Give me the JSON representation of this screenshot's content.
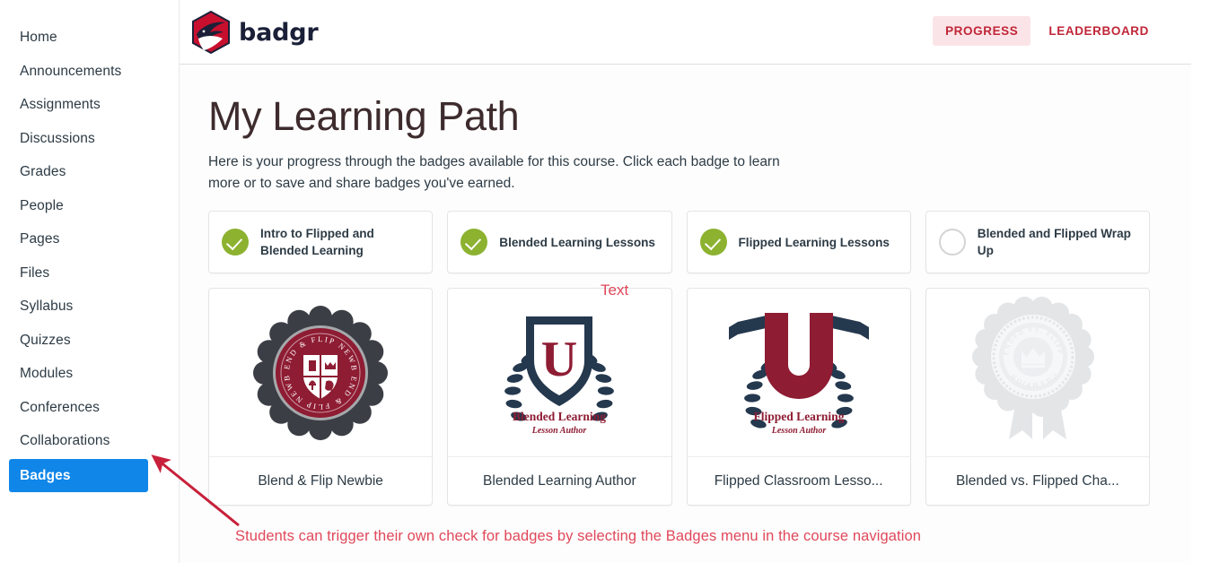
{
  "sidebar": {
    "items": [
      {
        "label": "Home",
        "active": false
      },
      {
        "label": "Announcements",
        "active": false
      },
      {
        "label": "Assignments",
        "active": false
      },
      {
        "label": "Discussions",
        "active": false
      },
      {
        "label": "Grades",
        "active": false
      },
      {
        "label": "People",
        "active": false
      },
      {
        "label": "Pages",
        "active": false
      },
      {
        "label": "Files",
        "active": false
      },
      {
        "label": "Syllabus",
        "active": false
      },
      {
        "label": "Quizzes",
        "active": false
      },
      {
        "label": "Modules",
        "active": false
      },
      {
        "label": "Conferences",
        "active": false
      },
      {
        "label": "Collaborations",
        "active": false
      },
      {
        "label": "Badges",
        "active": true
      }
    ],
    "active_item": "Badges",
    "active_color": "#0f86e8"
  },
  "appbar": {
    "brand_name": "badgr",
    "brand_icon": "badgr-hexagon-logo",
    "brand_colors": {
      "red": "#c8102e",
      "navy": "#1b2038"
    },
    "buttons": [
      {
        "label": "PROGRESS",
        "active": true
      },
      {
        "label": "LEADERBOARD",
        "active": false
      }
    ],
    "accent_color": "#c02638",
    "active_bg": "#fbe4e7"
  },
  "page": {
    "title": "My Learning Path",
    "description": "Here is your progress through the badges available for this course. Click each badge to learn more or to save and share badges you've earned."
  },
  "progress_items": [
    {
      "label": "Intro to Flipped and Blended Learning",
      "status": "complete",
      "icon": "check-circle-icon"
    },
    {
      "label": "Blended Learning Lessons",
      "status": "complete",
      "icon": "check-circle-icon"
    },
    {
      "label": "Flipped Learning Lessons",
      "status": "complete",
      "icon": "check-circle-icon"
    },
    {
      "label": "Blended and Flipped Wrap Up",
      "status": "incomplete",
      "icon": "empty-circle-icon"
    }
  ],
  "progress_colors": {
    "complete": "#8cb230",
    "incomplete": "#d2d4d6"
  },
  "badges": [
    {
      "name": "Blend & Flip Newbie",
      "art": "seal-crest",
      "earned": true,
      "art_text_top": "BLEND & FLIP NEWBIE",
      "art_text_bottom": "BLEND & FLIP NEWBIE"
    },
    {
      "name": "Blended Learning Author",
      "art": "shield-u-laurel",
      "earned": true,
      "art_letter": "U",
      "art_text_top": "Blended Learning",
      "art_text_bottom": "Lesson Author"
    },
    {
      "name": "Flipped Classroom Lesso...",
      "art": "u-laurel-banner",
      "earned": true,
      "art_letter": "U",
      "art_text_top": "Flipped Learning",
      "art_text_bottom": "Lesson Author"
    },
    {
      "name": "Blended vs. Flipped Cha...",
      "art": "rosette-crown",
      "earned": false,
      "art_text_top": "BLENDED VS. FLIPPED",
      "art_text_bottom": "CHAMPION"
    }
  ],
  "annotations": {
    "color": "#e0485a",
    "text_label": "Text",
    "sentence": "Students can trigger their own check for badges by selecting the Badges menu in the course navigation",
    "arrow": "arrow-pointing-to-badges-nav"
  }
}
